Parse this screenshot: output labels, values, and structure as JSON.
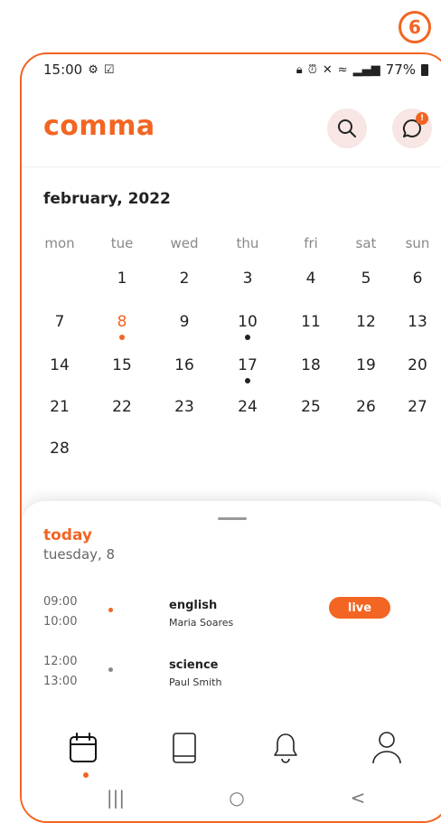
{
  "step": "6",
  "status": {
    "time": "15:00",
    "battery": "77%",
    "left_icons": [
      "gear-icon",
      "checkbox-icon"
    ],
    "right_icons": [
      "lock-icon",
      "alarm-icon",
      "mute-icon",
      "wifi-icon",
      "signal-icon",
      "battery-icon"
    ]
  },
  "app": {
    "name": "comma",
    "accent": "#f26522"
  },
  "header": {
    "search_icon": "search-icon",
    "chat_icon": "chat-icon",
    "notification_count": "!"
  },
  "calendar": {
    "month": "february, 2022",
    "weekdays": [
      "mon",
      "tue",
      "wed",
      "thu",
      "fri",
      "sat",
      "sun"
    ],
    "weeks": [
      [
        "",
        "1",
        "2",
        "3",
        "4",
        "5",
        "6"
      ],
      [
        "7",
        "8",
        "9",
        "10",
        "11",
        "12",
        "13"
      ],
      [
        "14",
        "15",
        "16",
        "17",
        "18",
        "19",
        "20"
      ],
      [
        "21",
        "22",
        "23",
        "24",
        "25",
        "26",
        "27"
      ],
      [
        "28",
        "",
        "",
        "",
        "",
        "",
        ""
      ]
    ],
    "today": "8",
    "event_days": [
      "10",
      "17"
    ]
  },
  "today_panel": {
    "label": "today",
    "date": "tuesday, 8",
    "events": [
      {
        "start": "09:00",
        "end": "10:00",
        "title": "english",
        "teacher": "Maria Soares",
        "live_label": "live",
        "bullet_color": "#f26522"
      },
      {
        "start": "12:00",
        "end": "13:00",
        "title": "science",
        "teacher": "Paul Smith",
        "live_label": "",
        "bullet_color": "#888888"
      }
    ]
  },
  "bottom_nav": [
    "calendar-icon",
    "book-icon",
    "bell-icon",
    "profile-icon"
  ],
  "system_nav": {
    "recents": "|||",
    "home": "○",
    "back": "<"
  }
}
